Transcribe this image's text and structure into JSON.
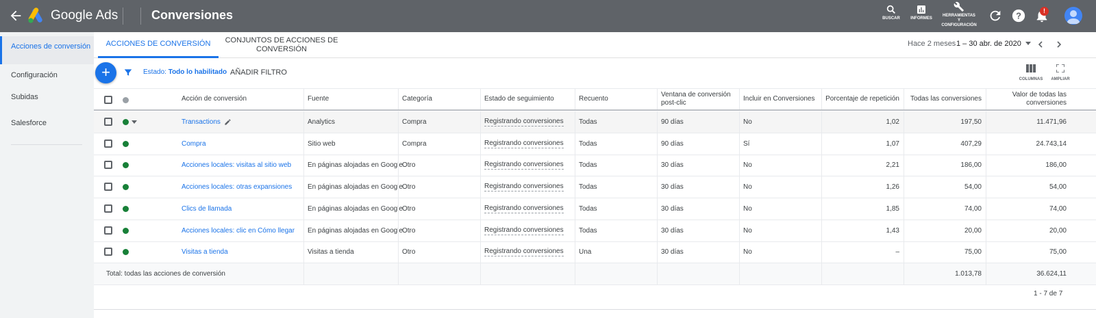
{
  "topbar": {
    "brand": "Google Ads",
    "title": "Conversiones",
    "tools": [
      {
        "name": "search",
        "label": "BUSCAR"
      },
      {
        "name": "reports",
        "label": "INFORMES"
      },
      {
        "name": "tools",
        "label": "HERRAMIENTAS Y CONFIGURACIÓN"
      }
    ],
    "notification_count": "!"
  },
  "sidebar": {
    "items": [
      {
        "label": "Acciones de conversión",
        "active": true
      },
      {
        "label": "Configuración"
      },
      {
        "label": "Subidas"
      },
      {
        "label": "Salesforce"
      }
    ]
  },
  "tabs": [
    {
      "label": "Acciones de conversión",
      "active": true
    },
    {
      "label": "Conjuntos de acciones de conversión"
    }
  ],
  "date": {
    "relative": "Hace 2 meses",
    "range": "1 – 30 abr. de 2020"
  },
  "toolbar": {
    "add": "+",
    "filter_prefix": "Estado:",
    "filter_value": "Todo lo habilitado",
    "add_filter": "Añadir filtro",
    "columns": "COLUMNAS",
    "expand": "AMPLIAR"
  },
  "table": {
    "headers": [
      "Acción de conversión",
      "Fuente",
      "Categoría",
      "Estado de seguimiento",
      "Recuento",
      "Ventana de conversión post-clic",
      "Incluir en Conversiones",
      "Porcentaje de repetición",
      "Todas las conversiones",
      "Valor de todas las conversiones"
    ],
    "rows": [
      {
        "action": "Transactions",
        "source": "Analytics",
        "category": "Compra",
        "status": "Registrando conversiones",
        "count": "Todas",
        "window": "90 días",
        "include": "No",
        "repeat": "1,02",
        "all_conv": "197,50",
        "value": "11.471,96"
      },
      {
        "action": "Compra",
        "source": "Sitio web",
        "category": "Compra",
        "status": "Registrando conversiones",
        "count": "Todas",
        "window": "90 días",
        "include": "Sí",
        "repeat": "1,07",
        "all_conv": "407,29",
        "value": "24.743,14"
      },
      {
        "action": "Acciones locales: visitas al sitio web",
        "source": "En páginas alojadas en Google",
        "category": "Otro",
        "status": "Registrando conversiones",
        "count": "Todas",
        "window": "30 días",
        "include": "No",
        "repeat": "2,21",
        "all_conv": "186,00",
        "value": "186,00"
      },
      {
        "action": "Acciones locales: otras expansiones",
        "source": "En páginas alojadas en Google",
        "category": "Otro",
        "status": "Registrando conversiones",
        "count": "Todas",
        "window": "30 días",
        "include": "No",
        "repeat": "1,26",
        "all_conv": "54,00",
        "value": "54,00"
      },
      {
        "action": "Clics de llamada",
        "source": "En páginas alojadas en Google",
        "category": "Otro",
        "status": "Registrando conversiones",
        "count": "Todas",
        "window": "30 días",
        "include": "No",
        "repeat": "1,85",
        "all_conv": "74,00",
        "value": "74,00"
      },
      {
        "action": "Acciones locales: clic en Cómo llegar",
        "source": "En páginas alojadas en Google",
        "category": "Otro",
        "status": "Registrando conversiones",
        "count": "Todas",
        "window": "30 días",
        "include": "No",
        "repeat": "1,43",
        "all_conv": "20,00",
        "value": "20,00"
      },
      {
        "action": "Visitas a tienda",
        "source": "Visitas a tienda",
        "category": "Otro",
        "status": "Registrando conversiones",
        "count": "Una",
        "window": "30 días",
        "include": "No",
        "repeat": "–",
        "all_conv": "75,00",
        "value": "75,00"
      }
    ],
    "total": {
      "label": "Total: todas las acciones de conversión",
      "all_conv": "1.013,78",
      "value": "36.624,11"
    },
    "pager": "1 - 7 de 7"
  },
  "colors": {
    "topbar": "#5f6368",
    "accent": "#1a73e8",
    "status_enabled": "#188038"
  }
}
